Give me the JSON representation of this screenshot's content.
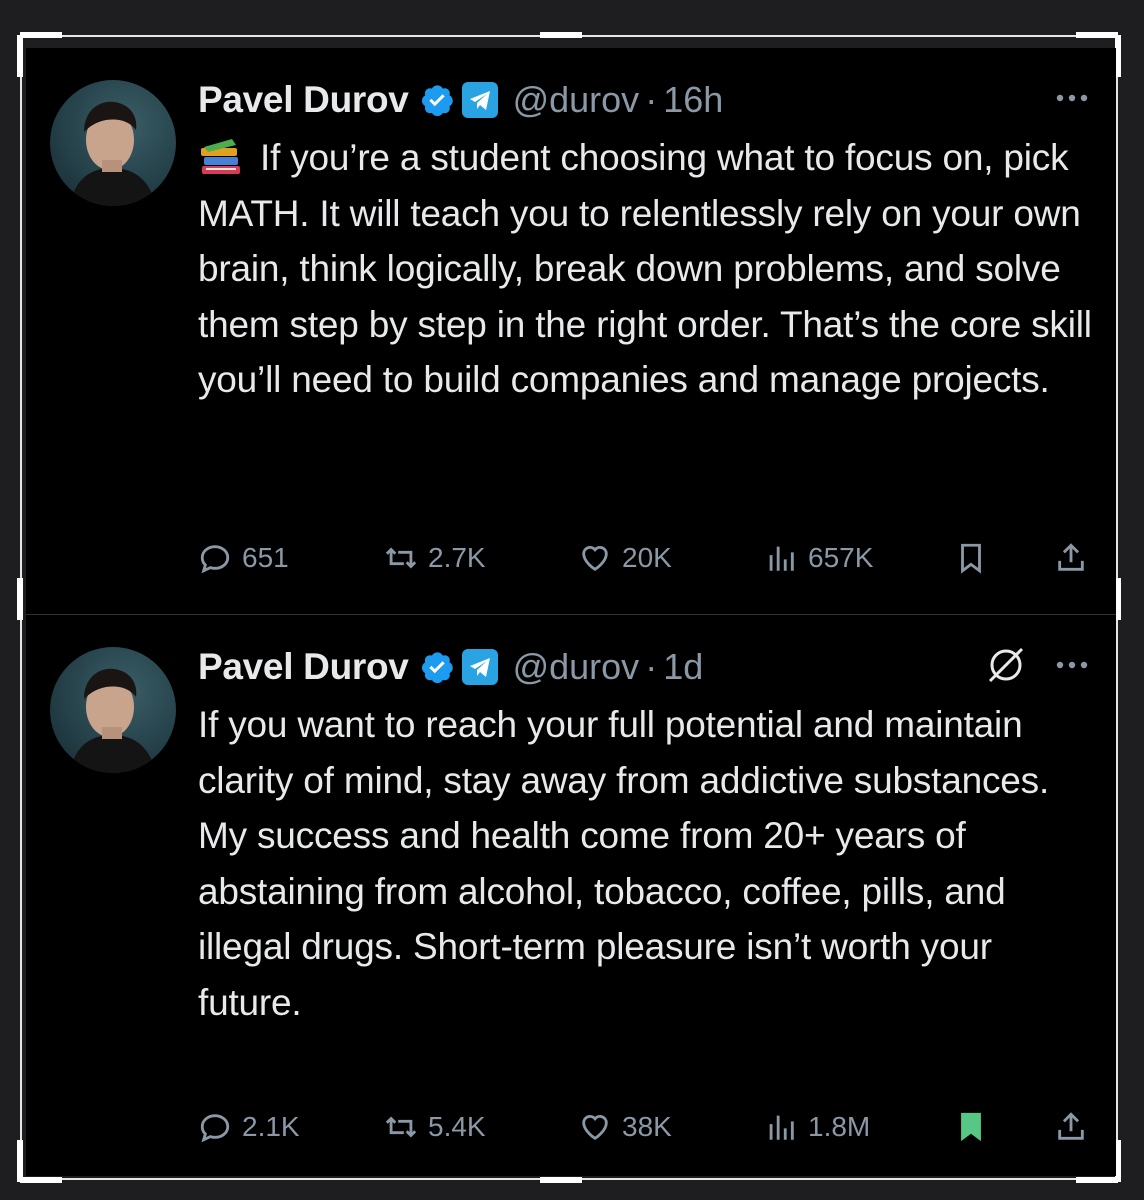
{
  "colors": {
    "background": "#000000",
    "text": "#e7e9ea",
    "muted": "#8b98a5",
    "verified_blue": "#1d9bf0",
    "telegram_blue": "#2aa3e3",
    "bookmark_active": "#57c785"
  },
  "tweets": [
    {
      "name": "Pavel Durov",
      "handle": "@durov",
      "separator": "·",
      "time": "16h",
      "icons": [
        "verified-badge-icon",
        "telegram-icon",
        "more-icon",
        "books-emoji-icon"
      ],
      "text": "If you’re a student choosing what to focus on, pick MATH. It will teach you to relentlessly rely on your own brain, think logically, break down problems, and solve them step by step in the right order. That’s the core skill you’ll need to build companies and manage projects.",
      "replies": "651",
      "reposts": "2.7K",
      "likes": "20K",
      "views": "657K",
      "bookmarked": false
    },
    {
      "name": "Pavel Durov",
      "handle": "@durov",
      "separator": "·",
      "time": "1d",
      "icons": [
        "verified-badge-icon",
        "telegram-icon",
        "grok-icon",
        "more-icon"
      ],
      "text": "If you want to reach your full potential and maintain clarity of mind, stay away from addictive substances. My success and health come from 20+ years of abstaining from alcohol, tobacco, coffee, pills, and illegal drugs. Short-term pleasure isn’t worth your future.",
      "replies": "2.1K",
      "reposts": "5.4K",
      "likes": "38K",
      "views": "1.8M",
      "bookmarked": true
    }
  ]
}
